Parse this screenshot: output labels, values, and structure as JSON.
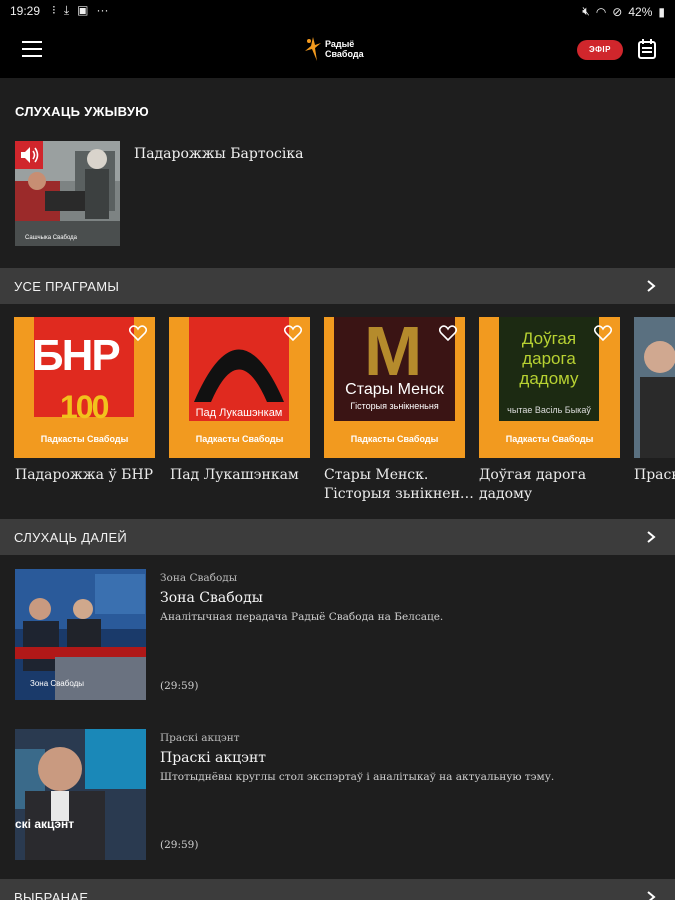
{
  "status": {
    "time": "19:29",
    "battery": "42%"
  },
  "header": {
    "logo_line1": "Радыё",
    "logo_line2": "Свабода",
    "live_label": "ЭФІР"
  },
  "live": {
    "section_title": "СЛУХАЦЬ УЖЫВУЮ",
    "program_title": "Падарожжы Бартосіка",
    "thumb_caption": "Сашчыка Свабода"
  },
  "programs": {
    "section_title": "УСЕ ПРАГРАМЫ",
    "podcast_tag": "Падкасты Свабоды",
    "items": [
      {
        "label": "Падарожжа ў БНР",
        "art_top": "БНР",
        "art_num": "100"
      },
      {
        "label": "Пад Лукашэнкам",
        "art_text": "Пад Лукашэнкам"
      },
      {
        "label": "Стары Менск. Гісторыя зьнікнен…",
        "art_text": "Стары Менск",
        "art_sub": "Гісторыя зьнікненьня"
      },
      {
        "label": "Доўгая дарога дадому",
        "art_text": "Доўгая дарога дадому",
        "art_sub": "чытае Васіль Быкаў"
      },
      {
        "label": "Праск"
      }
    ]
  },
  "continue": {
    "section_title": "СЛУХАЦЬ ДАЛЕЙ",
    "episodes": [
      {
        "program": "Зона Свабоды",
        "title": "Зона Свабоды",
        "description": "Аналітычная перадача Радыё Свабода на Белсаце.",
        "duration": "(29:59)",
        "thumb_caption": "Зона Свабоды"
      },
      {
        "program": "Праскі акцэнт",
        "title": "Праскі акцэнт",
        "description": "Штотыднёвы круглы стол экспэртаў і аналітыкаў на актуальную тэму.",
        "duration": "(29:59)",
        "thumb_caption": "скі акцэнт"
      }
    ]
  },
  "favorites": {
    "section_title": "ВЫБРАНАЕ"
  },
  "colors": {
    "accent_red": "#d0262c",
    "tile_orange": "#f29a1f",
    "background": "#1e1e1e",
    "section_bar": "#3c3c3c"
  },
  "icons": [
    "menu-icon",
    "radio-logo-icon",
    "schedule-icon",
    "speaker-icon",
    "heart-icon",
    "chevron-right-icon"
  ]
}
